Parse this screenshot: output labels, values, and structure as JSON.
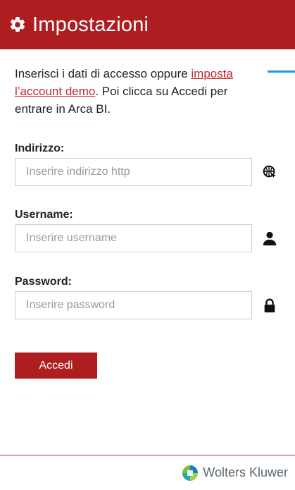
{
  "header": {
    "title": "Impostazioni",
    "icon": "gear-icon"
  },
  "intro": {
    "text_before": "Inserisci i dati di accesso oppure ",
    "link": "imposta l’account demo",
    "text_after": ". Poi clicca su Accedi per entrare in Arca BI."
  },
  "fields": {
    "address": {
      "label": "Indirizzo:",
      "placeholder": "Inserire indirizzo http",
      "value": "",
      "icon": "globe-icon"
    },
    "username": {
      "label": "Username:",
      "placeholder": "Inserire username",
      "value": "",
      "icon": "user-icon"
    },
    "password": {
      "label": "Password:",
      "placeholder": "Inserire password",
      "value": "",
      "icon": "lock-icon"
    }
  },
  "login_button": "Accedi",
  "footer": {
    "brand": "Wolters Kluwer",
    "logo": "wolters-kluwer-logo"
  },
  "colors": {
    "primary": "#ae1d1f",
    "link": "#c0282d",
    "accent": "#1aa0d8",
    "brand_text": "#5b6770"
  }
}
